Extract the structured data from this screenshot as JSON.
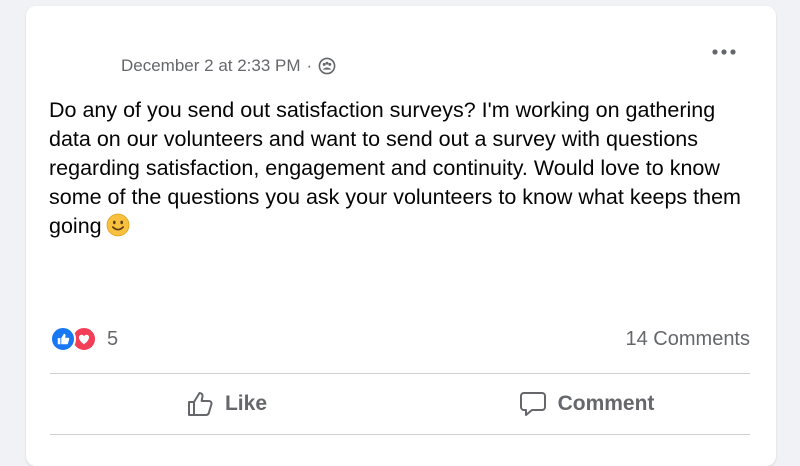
{
  "post": {
    "timestamp": "December 2 at 2:33 PM",
    "separator": "·",
    "audience_icon": "group-icon",
    "more_icon": "more-options-icon",
    "text": "Do any of you send out satisfaction surveys? I'm working on gathering data on our volunteers and want to send out a survey with questions regarding satisfaction, engagement and continuity. Would love to know some of the questions you ask your volunteers to know what keeps them going",
    "emoji": "slightly-smiling-face-emoji"
  },
  "stats": {
    "reactions": [
      "like",
      "love"
    ],
    "reaction_count": "5",
    "comments": "14 Comments"
  },
  "actions": {
    "like_label": "Like",
    "comment_label": "Comment"
  },
  "colors": {
    "like_blue": "#1877f2",
    "love_red": "#f33e58",
    "secondary_text": "#65676b",
    "primary_text": "#050505"
  }
}
